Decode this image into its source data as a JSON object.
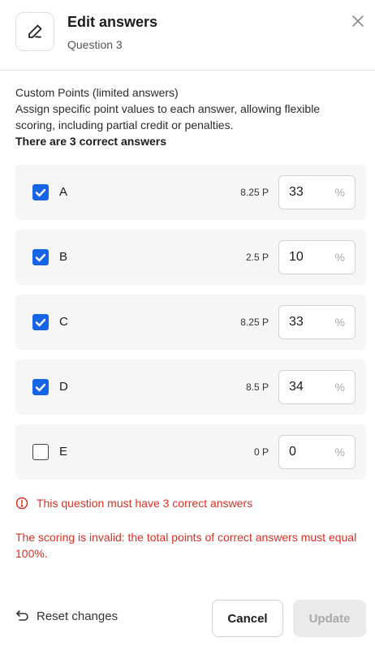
{
  "header": {
    "title": "Edit answers",
    "subtitle": "Question 3",
    "icon": "pen-icon"
  },
  "description": {
    "heading": "Custom Points (limited answers)",
    "body": "Assign specific point values to each answer, allowing flexible scoring, including partial credit or penalties.",
    "note": "There are 3 correct answers"
  },
  "answers": [
    {
      "letter": "A",
      "checked": true,
      "points": "8.25 P",
      "percent": "33",
      "unit": "%"
    },
    {
      "letter": "B",
      "checked": true,
      "points": "2.5 P",
      "percent": "10",
      "unit": "%"
    },
    {
      "letter": "C",
      "checked": true,
      "points": "8.25 P",
      "percent": "33",
      "unit": "%"
    },
    {
      "letter": "D",
      "checked": true,
      "points": "8.5 P",
      "percent": "34",
      "unit": "%"
    },
    {
      "letter": "E",
      "checked": false,
      "points": "0 P",
      "percent": "0",
      "unit": "%"
    }
  ],
  "errors": {
    "count_error": "This question must have 3 correct answers",
    "scoring_error": "The scoring is invalid: the total points of correct answers must equal 100%."
  },
  "footer": {
    "reset_label": "Reset changes",
    "cancel_label": "Cancel",
    "update_label": "Update"
  },
  "colors": {
    "accent": "#1565e6",
    "error": "#d93025",
    "row_bg": "#f6f6f7",
    "disabled_bg": "#ebebeb"
  }
}
